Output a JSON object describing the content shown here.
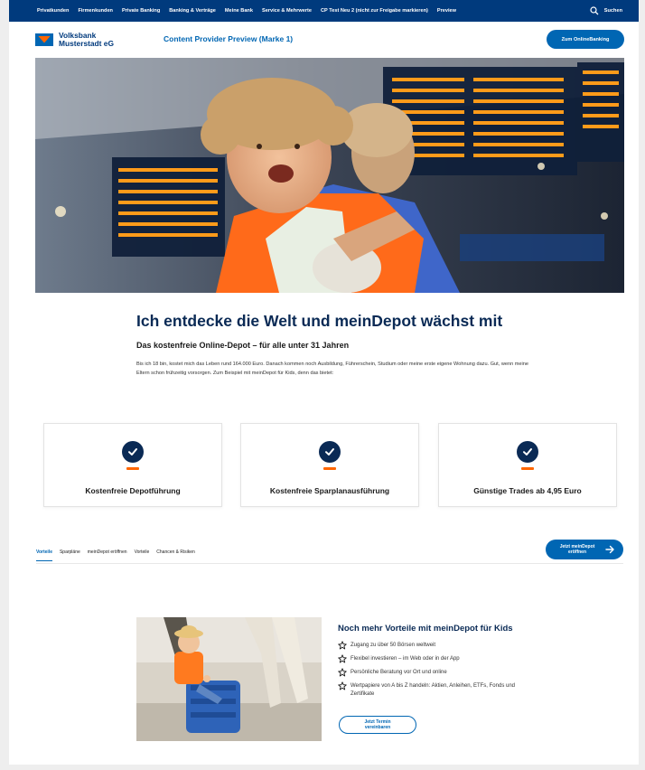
{
  "topnav": {
    "items": [
      "Privatkunden",
      "Firmenkunden",
      "Private Banking",
      "Banking & Verträge",
      "Meine Bank",
      "Service & Mehrwerte",
      "CP Test Neu 2 (nicht zur Freigabe markieren)",
      "Preview"
    ],
    "search_label": "Suchen"
  },
  "header": {
    "logo_line1": "Volksbank",
    "logo_line2": "Musterstadt eG",
    "title": "Content Provider Preview (Marke 1)",
    "cta_label": "Zum OnlineBanking"
  },
  "intro": {
    "title": "Ich entdecke die Welt und meinDepot wächst mit",
    "subtitle": "Das kostenfreie Online-Depot – für alle unter 31 Jahren",
    "text": "Bis ich 18 bin, kostet mich das Leben rund 164.000 Euro. Danach kommen noch Ausbildung, Führerschein, Studium oder meine erste eigene Wohnung dazu. Gut, wenn meine Eltern schon frühzeitig vorsorgen. Zum Beispiel mit meinDepot für Kids, denn das bietet:"
  },
  "features": [
    {
      "label": "Kostenfreie Depotführung"
    },
    {
      "label": "Kostenfreie Sparplanausführung"
    },
    {
      "label": "Günstige Trades ab 4,95 Euro"
    }
  ],
  "tabs": [
    "Vorteile",
    "Sparpläne",
    "meinDepot eröffnen",
    "Vorteile",
    "Chancen & Risiken"
  ],
  "depot_cta": {
    "line1": "Jetzt meinDepot",
    "line2": "eröffnen"
  },
  "kids": {
    "title": "Noch mehr Vorteile mit meinDepot für Kids",
    "items": [
      "Zugang zu über 50 Börsen weltweit",
      "Flexibel investieren – im Web oder in der App",
      "Persönliche Beratung vor Ort und online",
      "Wertpapiere von A bis Z handeln: Aktien, Anleihen, ETFs, Fonds und Zertifikate"
    ],
    "cta_line1": "Jetzt Termin",
    "cta_line2": "vereinbaren"
  },
  "colors": {
    "brand_blue": "#0066b3",
    "navy": "#003a7d",
    "accent_orange": "#ff6600"
  },
  "icons": [
    "search-icon",
    "check-icon",
    "arrow-right-icon",
    "star-icon"
  ]
}
